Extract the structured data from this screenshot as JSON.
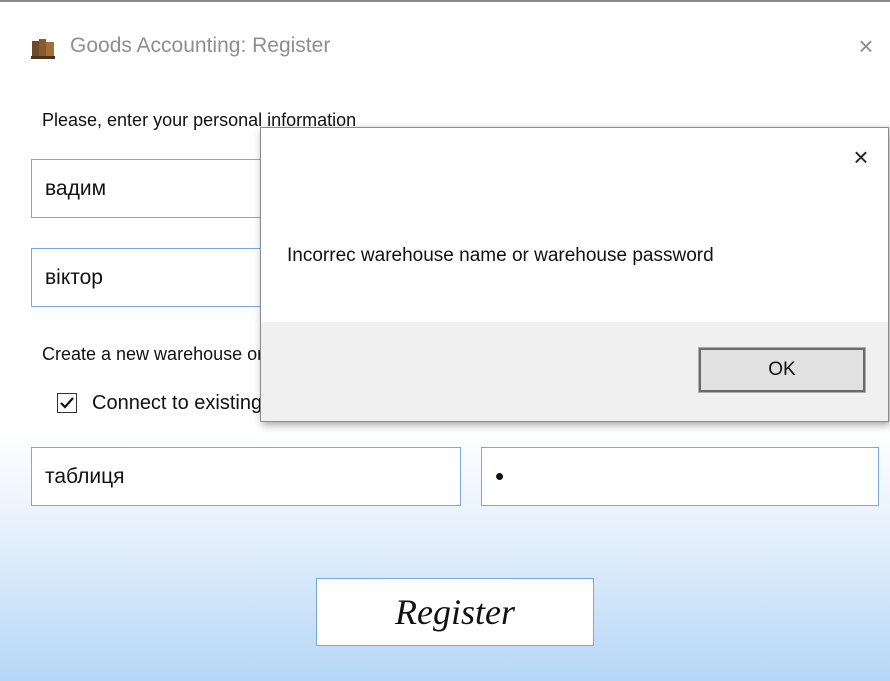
{
  "window": {
    "title": "Goods Accounting: Register",
    "close_glyph": "×",
    "icon": "books-icon"
  },
  "form": {
    "personal_info_label": "Please, enter your personal information",
    "first_name_value": "вадим",
    "last_name_value": "віктор",
    "warehouse_label": "Create a new warehouse or connect to existing",
    "connect_checkbox_label": "Connect to existing warehouse",
    "connect_checked": true,
    "warehouse_name_value": "таблиця",
    "warehouse_password_value": "•",
    "register_label": "Register"
  },
  "dialog": {
    "message": "Incorrec warehouse name or warehouse password",
    "close_glyph": "×",
    "ok_label": "OK"
  }
}
